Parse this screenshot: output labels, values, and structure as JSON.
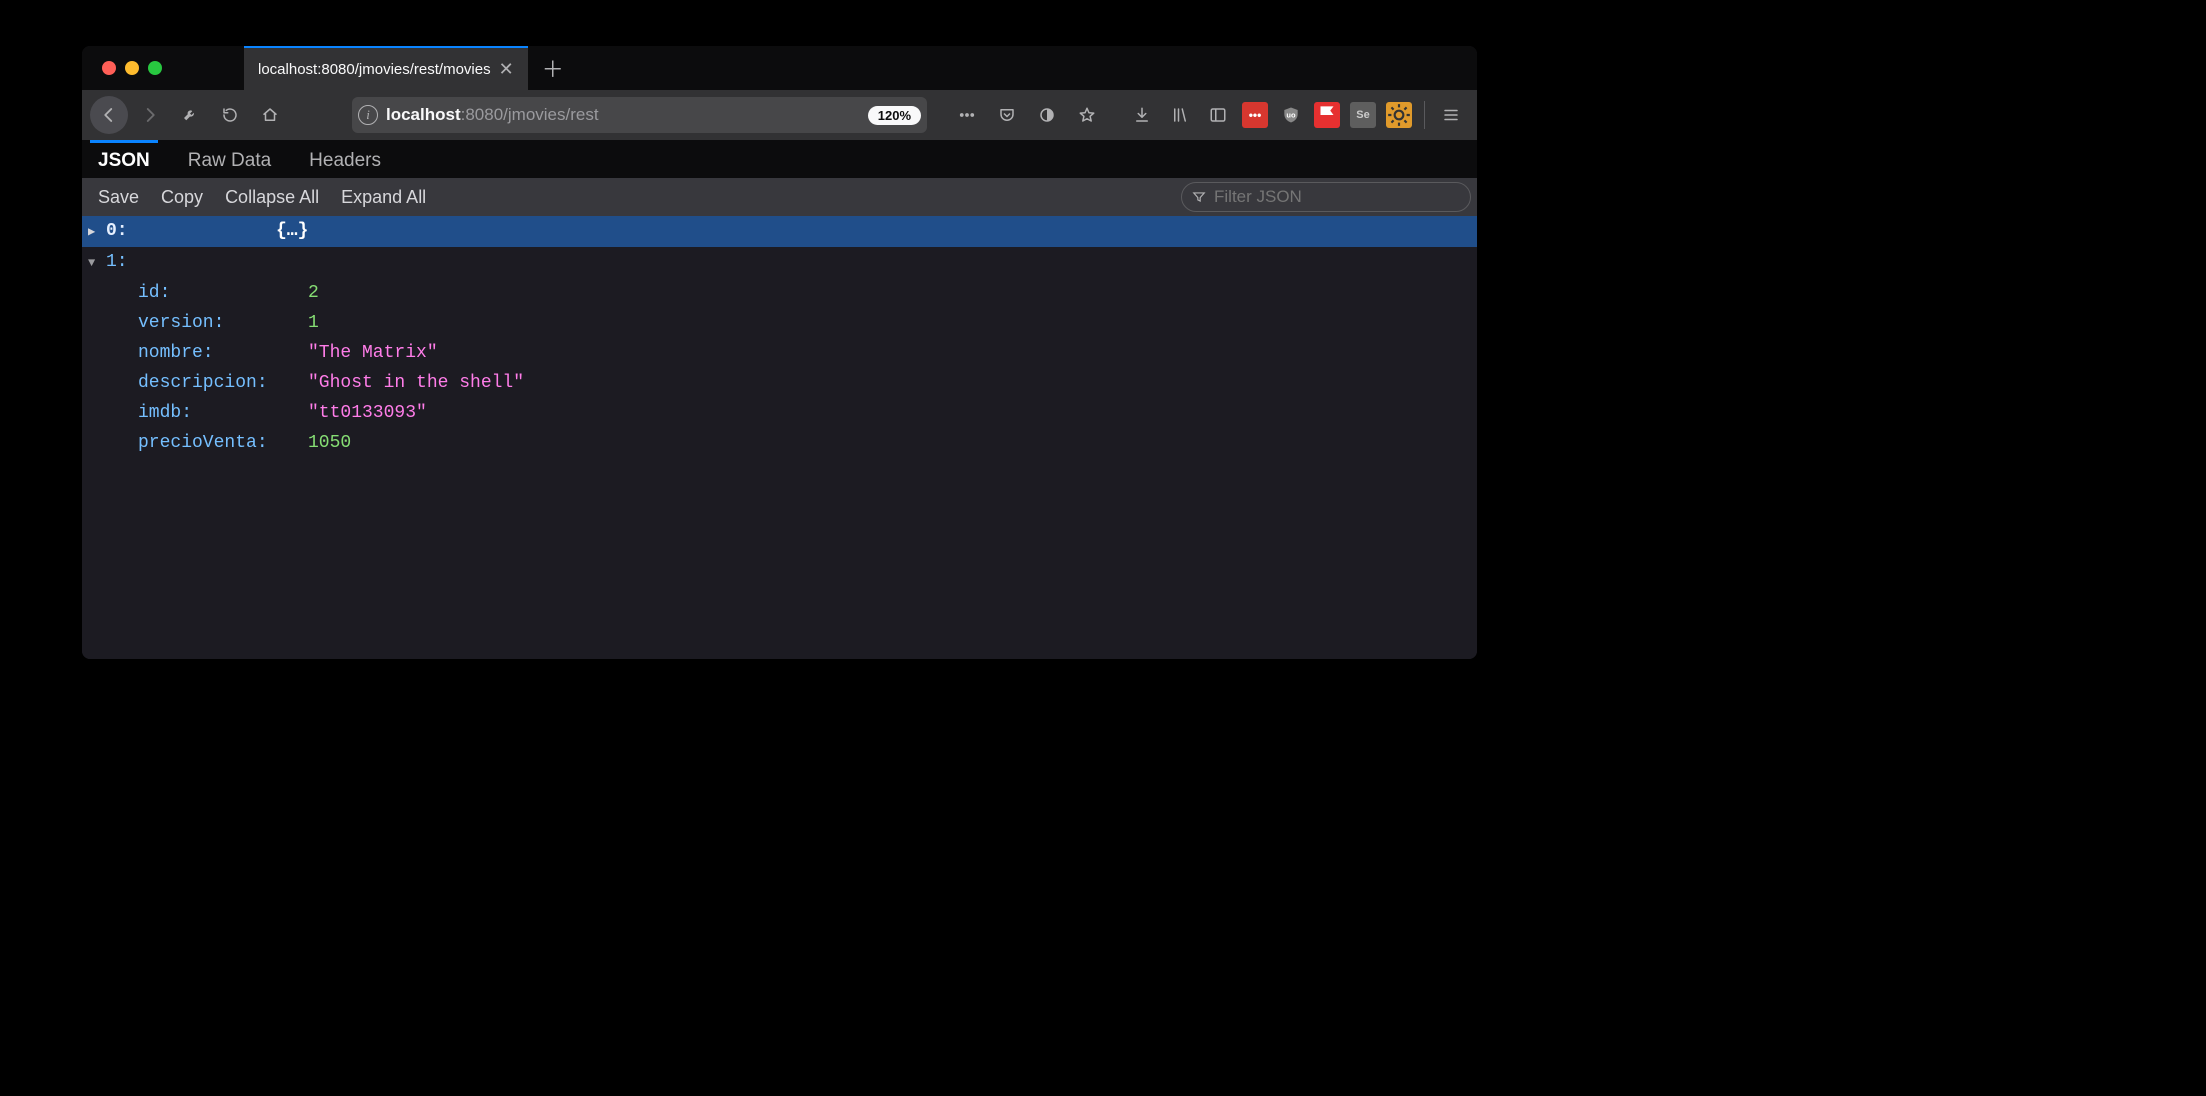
{
  "tab": {
    "title": "localhost:8080/jmovies/rest/movies"
  },
  "url": {
    "host": "localhost",
    "path": ":8080/jmovies/rest",
    "zoom": "120%"
  },
  "viewerTabs": {
    "json": "JSON",
    "raw": "Raw Data",
    "headers": "Headers"
  },
  "actions": {
    "save": "Save",
    "copy": "Copy",
    "collapse": "Collapse All",
    "expand": "Expand All"
  },
  "filter": {
    "placeholder": "Filter JSON"
  },
  "tree": {
    "item0": {
      "key": "0:",
      "brace": "{…}"
    },
    "item1": {
      "key": "1:",
      "props": {
        "id": {
          "key": "id:",
          "value": "2",
          "type": "num"
        },
        "version": {
          "key": "version:",
          "value": "1",
          "type": "num"
        },
        "nombre": {
          "key": "nombre:",
          "value": "\"The Matrix\"",
          "type": "str"
        },
        "descripcion": {
          "key": "descripcion:",
          "value": "\"Ghost in the shell\"",
          "type": "str"
        },
        "imdb": {
          "key": "imdb:",
          "value": "\"tt0133093\"",
          "type": "str"
        },
        "precioVenta": {
          "key": "precioVenta:",
          "value": "1050",
          "type": "num"
        }
      }
    }
  },
  "extLabels": {
    "lastpass": "•••",
    "ublock": "uo",
    "se": "Se"
  }
}
